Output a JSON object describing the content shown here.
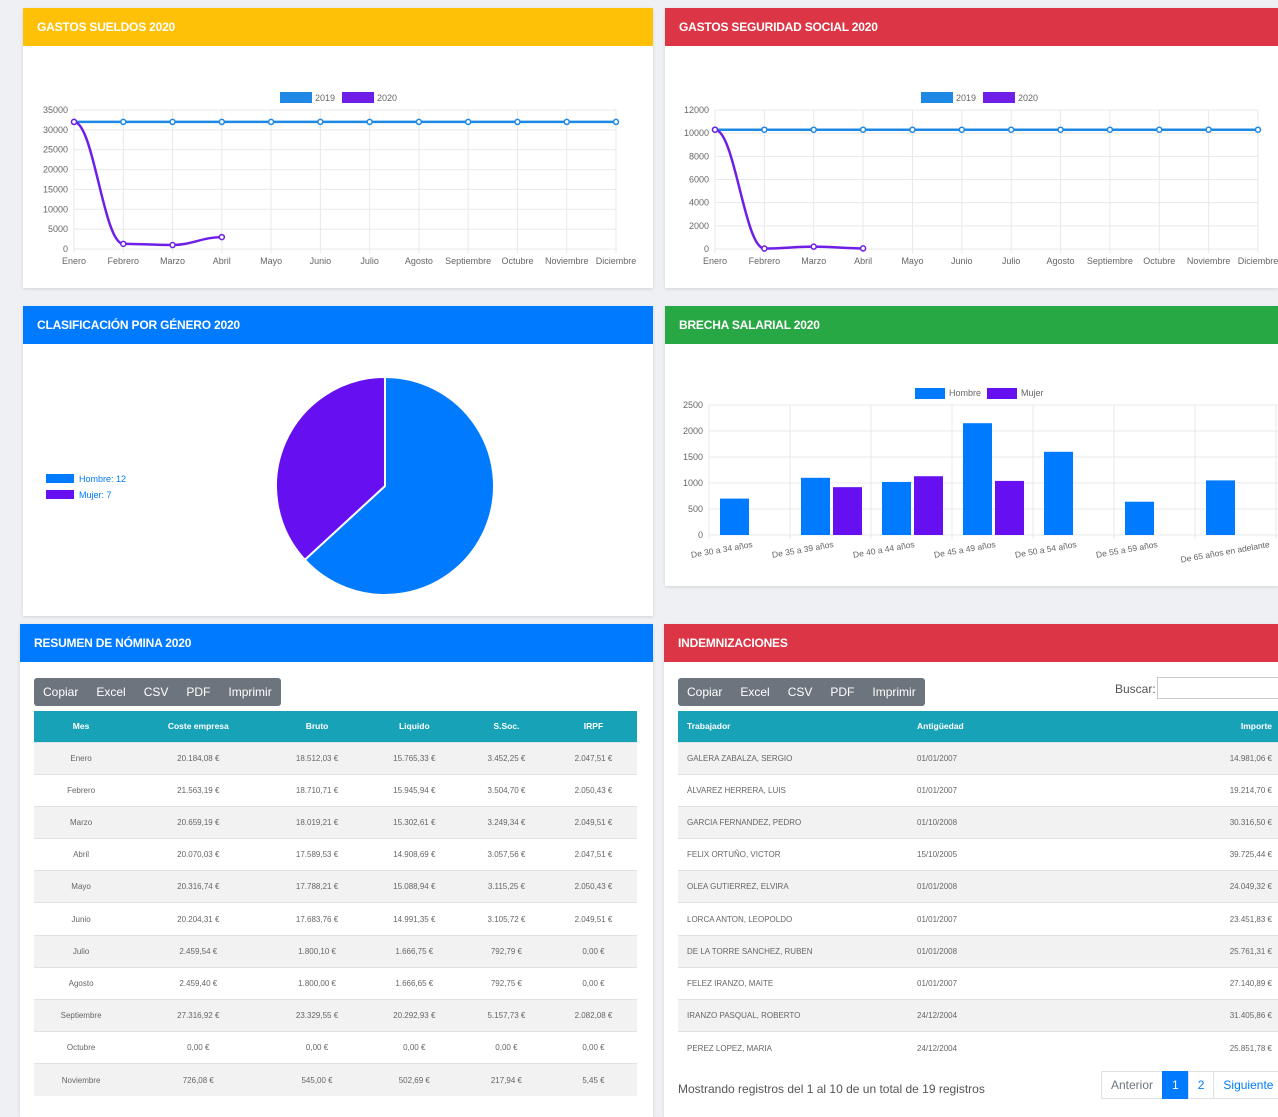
{
  "cards": {
    "sueldos": {
      "title": "GASTOS SUELDOS 2020"
    },
    "ssocial": {
      "title": "GASTOS SEGURIDAD SOCIAL 2020"
    },
    "genero": {
      "title": "CLASIFICACIÓN POR GÉNERO 2020"
    },
    "brecha": {
      "title": "BRECHA SALARIAL 2020"
    },
    "nomina": {
      "title": "RESUMEN DE NÓMINA 2020"
    },
    "indemnizaciones": {
      "title": "INDEMNIZACIONES"
    }
  },
  "colors": {
    "yellow": "#ffc107",
    "red": "#dc3545",
    "blue": "#007bff",
    "green": "#28a745",
    "series2019": "#1e88e5",
    "series2020": "#6f1ee8"
  },
  "chart_data": [
    {
      "type": "line",
      "title": "GASTOS SUELDOS 2020",
      "categories": [
        "Enero",
        "Febrero",
        "Marzo",
        "Abril",
        "Mayo",
        "Junio",
        "Julio",
        "Agosto",
        "Septiembre",
        "Octubre",
        "Noviembre",
        "Diciembre"
      ],
      "series": [
        {
          "name": "2019",
          "values": [
            32000,
            32000,
            32000,
            32000,
            32000,
            32000,
            32000,
            32000,
            32000,
            32000,
            32000,
            32000
          ]
        },
        {
          "name": "2020",
          "values": [
            32000,
            1300,
            1000,
            3000
          ]
        }
      ],
      "yticks": [
        "0",
        "5000",
        "10000",
        "15000",
        "20000",
        "25000",
        "30000",
        "35000"
      ],
      "ylim": [
        0,
        35000
      ],
      "legend": "top-center"
    },
    {
      "type": "line",
      "title": "GASTOS SEGURIDAD SOCIAL 2020",
      "categories": [
        "Enero",
        "Febrero",
        "Marzo",
        "Abril",
        "Mayo",
        "Junio",
        "Julio",
        "Agosto",
        "Septiembre",
        "Octubre",
        "Noviembre",
        "Diciembre"
      ],
      "series": [
        {
          "name": "2019",
          "values": [
            10300,
            10300,
            10300,
            10300,
            10300,
            10300,
            10300,
            10300,
            10300,
            10300,
            10300,
            10300
          ]
        },
        {
          "name": "2020",
          "values": [
            10300,
            40,
            200,
            50
          ]
        }
      ],
      "yticks": [
        "0",
        "2000",
        "4000",
        "6000",
        "8000",
        "10000",
        "12000"
      ],
      "ylim": [
        0,
        12000
      ],
      "legend": "top-center"
    },
    {
      "type": "pie",
      "title": "CLASIFICACIÓN POR GÉNERO 2020",
      "labels": [
        "Hombre: 12",
        "Mujer: 7"
      ],
      "values": [
        12,
        7
      ],
      "legend": "left"
    },
    {
      "type": "bar",
      "title": "BRECHA SALARIAL 2020",
      "categories": [
        "De 30 a 34 años",
        "De 35 a 39 años",
        "De 40 a 44 años",
        "De 45 a 49 años",
        "De 50 a 54 años",
        "De 55 a 59 años",
        "De 65 años en adelante"
      ],
      "series": [
        {
          "name": "Hombre",
          "values": [
            700,
            1100,
            1020,
            2150,
            1600,
            640,
            1050
          ]
        },
        {
          "name": "Mujer",
          "values": [
            0,
            920,
            1130,
            1040,
            0,
            0,
            0
          ]
        }
      ],
      "yticks": [
        "0",
        "500",
        "1000",
        "1500",
        "2000",
        "2500"
      ],
      "ylim": [
        0,
        2500
      ],
      "legend": "top-center"
    }
  ],
  "nomina": {
    "buttons": [
      "Copiar",
      "Excel",
      "CSV",
      "PDF",
      "Imprimir"
    ],
    "columns": [
      "Mes",
      "Coste empresa",
      "Bruto",
      "Liquido",
      "S.Soc.",
      "IRPF"
    ],
    "rows": [
      [
        "Enero",
        "20.184,08 €",
        "18.512,03 €",
        "15.765,33 €",
        "3.452,25 €",
        "2.047,51 €"
      ],
      [
        "Febrero",
        "21.563,19 €",
        "18.710,71 €",
        "15.945,94 €",
        "3.504,70 €",
        "2.050,43 €"
      ],
      [
        "Marzo",
        "20.659,19 €",
        "18.019,21 €",
        "15.302,61 €",
        "3.249,34 €",
        "2.049,51 €"
      ],
      [
        "Abril",
        "20.070,03 €",
        "17.589,53 €",
        "14.908,69 €",
        "3.057,56 €",
        "2.047,51 €"
      ],
      [
        "Mayo",
        "20.316,74 €",
        "17.788,21 €",
        "15.088,94 €",
        "3.115,25 €",
        "2.050,43 €"
      ],
      [
        "Junio",
        "20.204,31 €",
        "17.683,76 €",
        "14.991,35 €",
        "3.105,72 €",
        "2.049,51 €"
      ],
      [
        "Julio",
        "2.459,54 €",
        "1.800,10 €",
        "1.666,75 €",
        "792,79 €",
        "0,00 €"
      ],
      [
        "Agosto",
        "2.459,40 €",
        "1.800,00 €",
        "1.666,65 €",
        "792,75 €",
        "0,00 €"
      ],
      [
        "Septiembre",
        "27.316,92 €",
        "23.329,55 €",
        "20.292,93 €",
        "5.157,73 €",
        "2.082,08 €"
      ],
      [
        "Octubre",
        "0,00 €",
        "0,00 €",
        "0,00 €",
        "0,00 €",
        "0,00 €"
      ],
      [
        "Noviembre",
        "726,08 €",
        "545,00 €",
        "502,69 €",
        "217,94 €",
        "5,45 €"
      ]
    ]
  },
  "indemnizaciones": {
    "buttons": [
      "Copiar",
      "Excel",
      "CSV",
      "PDF",
      "Imprimir"
    ],
    "search_label": "Buscar:",
    "columns": [
      "Trabajador",
      "Antigüedad",
      "Importe"
    ],
    "rows": [
      [
        "GALERA ZABALZA, SERGIO",
        "01/01/2007",
        "14.981,06 €"
      ],
      [
        "ÁLVAREZ HERRERA, LUIS",
        "01/01/2007",
        "19.214,70 €"
      ],
      [
        "GARCIA FERNANDEZ, PEDRO",
        "01/10/2008",
        "30.316,50 €"
      ],
      [
        "FELIX ORTUÑO, VICTOR",
        "15/10/2005",
        "39.725,44 €"
      ],
      [
        "OLEA GUTIERREZ, ELVIRA",
        "01/01/2008",
        "24.049,32 €"
      ],
      [
        "LORCA ANTON, LEOPOLDO",
        "01/01/2007",
        "23.451,83 €"
      ],
      [
        "DE LA TORRE SANCHEZ, RUBEN",
        "01/01/2008",
        "25.761,31 €"
      ],
      [
        "FELEZ IRANZO, MAITE",
        "01/01/2007",
        "27.140,89 €"
      ],
      [
        "IRANZO PASQUAL, ROBERTO",
        "24/12/2004",
        "31.405,86 €"
      ],
      [
        "PEREZ LOPEZ, MARIA",
        "24/12/2004",
        "25.851,78 €"
      ]
    ],
    "info": "Mostrando registros del 1 al 10 de un total de 19 registros",
    "pager": {
      "prev": "Anterior",
      "pages": [
        "1",
        "2"
      ],
      "next": "Siguiente"
    }
  }
}
